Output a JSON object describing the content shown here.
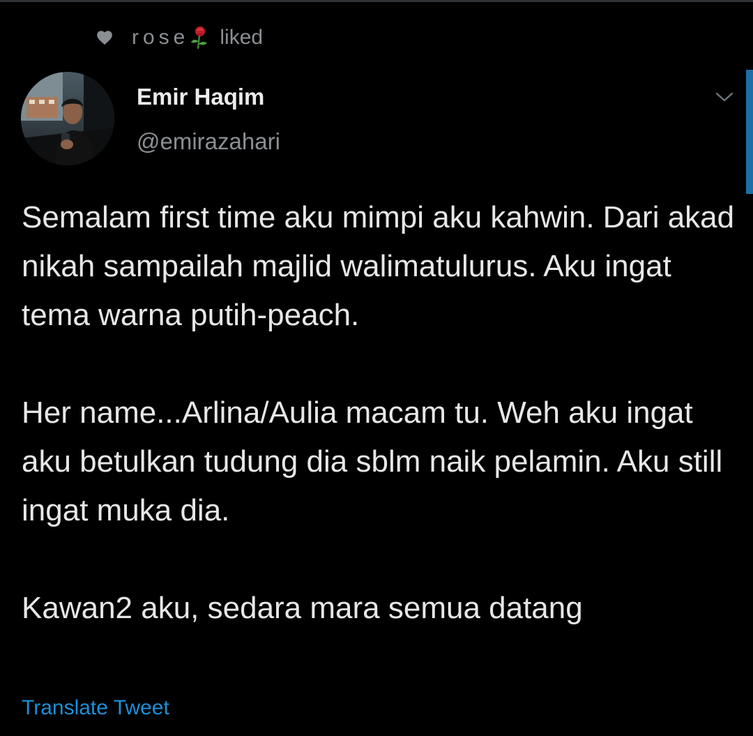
{
  "social_context": {
    "icon": "heart-icon",
    "liker_name": "rose",
    "liker_emoji": "rose-emoji-icon",
    "action": "liked"
  },
  "author": {
    "display_name": "Emir Haqim",
    "handle": "@emirazahari",
    "avatar": "profile-photo"
  },
  "tweet": {
    "paragraphs": [
      "Semalam first time aku mimpi aku kahwin. Dari akad nikah sampailah majlid walimatulurus. Aku ingat tema warna putih-peach.",
      "Her name...Arlina/Aulia macam tu. Weh aku ingat aku betulkan tudung dia sblm naik pelamin. Aku still ingat muka dia.",
      "Kawan2 aku, sedara mara semua datang"
    ]
  },
  "actions": {
    "translate_label": "Translate Tweet",
    "more_menu_icon": "chevron-down-icon"
  },
  "colors": {
    "background": "#000000",
    "text": "#e7e7e7",
    "secondary_text": "#8b8f94",
    "link": "#1d8fd8"
  }
}
